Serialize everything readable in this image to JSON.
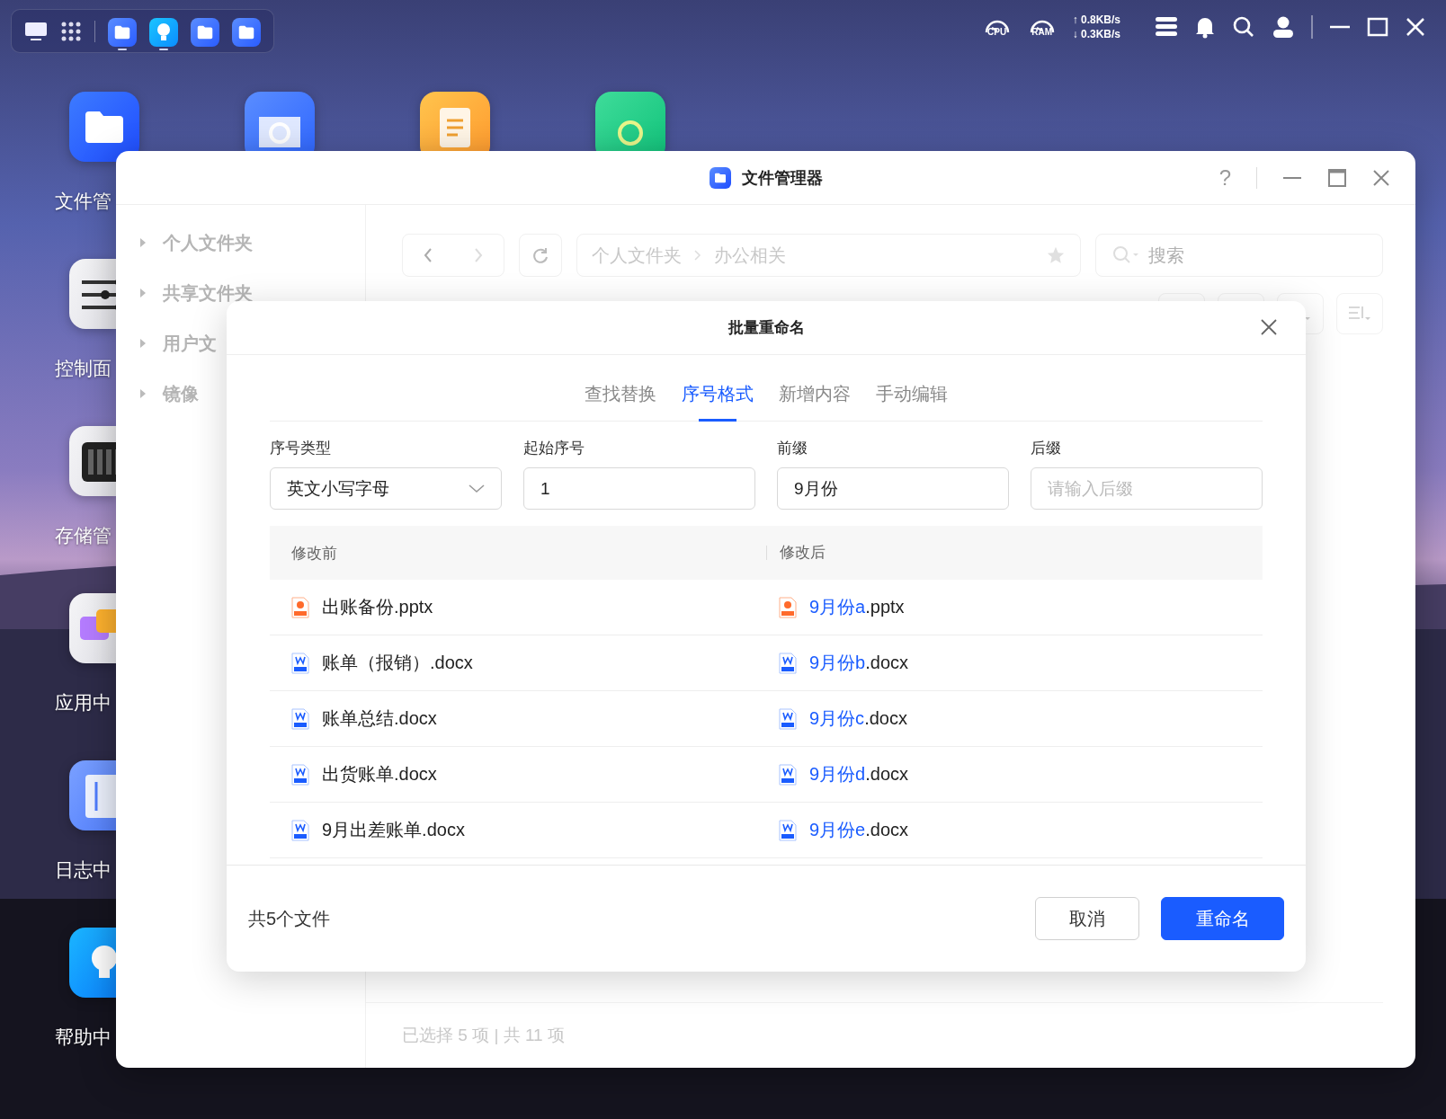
{
  "taskbar": {
    "apps": [
      {
        "kind": "folder",
        "running": true
      },
      {
        "kind": "bulb",
        "running": true
      },
      {
        "kind": "folder",
        "running": false
      },
      {
        "kind": "folder",
        "running": false
      }
    ]
  },
  "status": {
    "cpu_label": "CPU",
    "ram_label": "RAM",
    "upload": "↑ 0.8KB/s",
    "download": "↓ 0.3KB/s"
  },
  "desktop_icons": [
    {
      "kind": "files",
      "label": "文件管"
    },
    {
      "kind": "backup"
    },
    {
      "kind": "notes"
    },
    {
      "kind": "sync"
    },
    {
      "kind": "control",
      "label": "控制面"
    },
    {
      "kind": "storage",
      "label": "存储管"
    },
    {
      "kind": "apps",
      "label": "应用中"
    },
    {
      "kind": "log",
      "label": "日志中"
    },
    {
      "kind": "help",
      "label": "帮助中"
    }
  ],
  "window": {
    "title": "文件管理器",
    "help": "?",
    "sidebar": {
      "items": [
        {
          "label": "个人文件夹"
        },
        {
          "label": "共享文件夹"
        },
        {
          "label": "用户文"
        },
        {
          "label": "镜像"
        }
      ]
    },
    "path": [
      "个人文件夹",
      "办公相关"
    ],
    "search": {
      "placeholder": "搜索"
    },
    "status_bar": "已选择 5 项 | 共 11 项"
  },
  "dialog": {
    "title": "批量重命名",
    "tabs": [
      {
        "label": "查找替换",
        "selected": false
      },
      {
        "label": "序号格式",
        "selected": true
      },
      {
        "label": "新增内容",
        "selected": false
      },
      {
        "label": "手动编辑",
        "selected": false
      }
    ],
    "fields": [
      {
        "kind": "select",
        "label": "序号类型",
        "value": "英文小写字母"
      },
      {
        "kind": "input",
        "label": "起始序号",
        "value": "1"
      },
      {
        "kind": "input",
        "label": "前缀",
        "value": "9月份"
      },
      {
        "kind": "input",
        "label": "后缀",
        "placeholder": "请输入后缀"
      }
    ],
    "columns": [
      "修改前",
      "修改后"
    ],
    "rows": [
      {
        "kind": "pptx",
        "before": "出账备份.pptx",
        "after_new": "9月份a",
        "after_ext": ".pptx"
      },
      {
        "kind": "docx",
        "before": "账单（报销）.docx",
        "after_new": "9月份b",
        "after_ext": ".docx"
      },
      {
        "kind": "docx",
        "before": "账单总结.docx",
        "after_new": "9月份c",
        "after_ext": ".docx"
      },
      {
        "kind": "docx",
        "before": "出货账单.docx",
        "after_new": "9月份d",
        "after_ext": ".docx"
      },
      {
        "kind": "docx",
        "before": "9月出差账单.docx",
        "after_new": "9月份e",
        "after_ext": ".docx"
      }
    ],
    "count": "共5个文件",
    "buttons": [
      {
        "kind": "secondary",
        "label": "取消"
      },
      {
        "kind": "primary",
        "label": "重命名"
      }
    ]
  }
}
